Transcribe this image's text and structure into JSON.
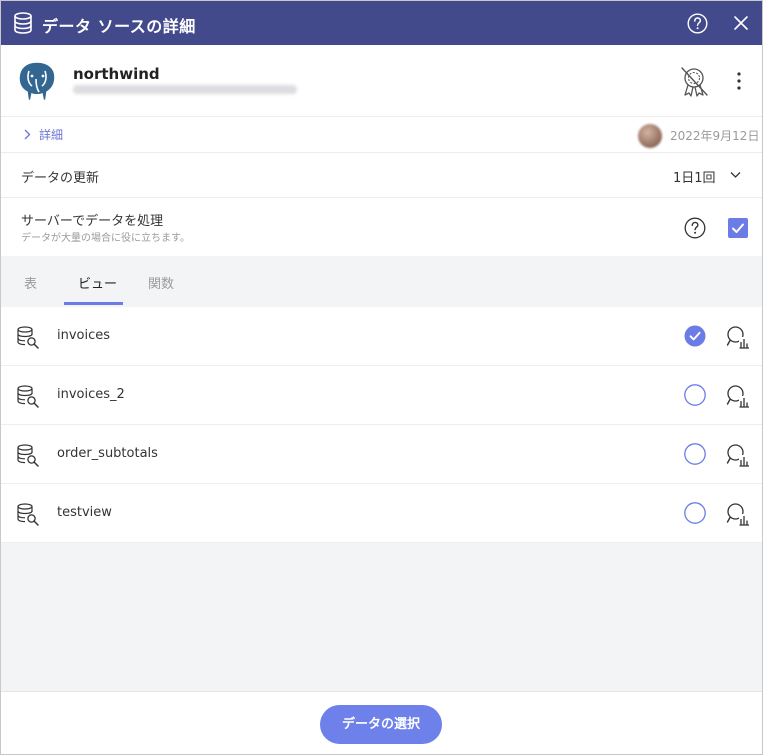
{
  "header": {
    "title": "データ ソースの詳細",
    "icon": "database-icon",
    "help_icon": "help-icon",
    "close_icon": "close-icon",
    "background": "#434a8c"
  },
  "connection": {
    "name": "northwind",
    "logo": "postgresql-elephant-icon",
    "badge_icon": "certified-badge-off-icon",
    "menu_icon": "kebab-menu-icon"
  },
  "details": {
    "label": "詳細",
    "date": "2022年9月12日"
  },
  "refresh": {
    "label": "データの更新",
    "value": "1日1回"
  },
  "server_processing": {
    "label": "サーバーでデータを処理",
    "description": "データが大量の場合に役に立ちます。",
    "checked": true
  },
  "tabs": [
    {
      "label": "表",
      "active": false
    },
    {
      "label": "ビュー",
      "active": true
    },
    {
      "label": "関数",
      "active": false
    }
  ],
  "views": [
    {
      "name": "invoices",
      "selected": true
    },
    {
      "name": "invoices_2",
      "selected": false
    },
    {
      "name": "order_subtotals",
      "selected": false
    },
    {
      "name": "testview",
      "selected": false
    }
  ],
  "footer": {
    "select_button": "データの選択"
  },
  "colors": {
    "accent": "#6b7ce6",
    "link": "#6b74d6",
    "button": "#6e80ea"
  }
}
